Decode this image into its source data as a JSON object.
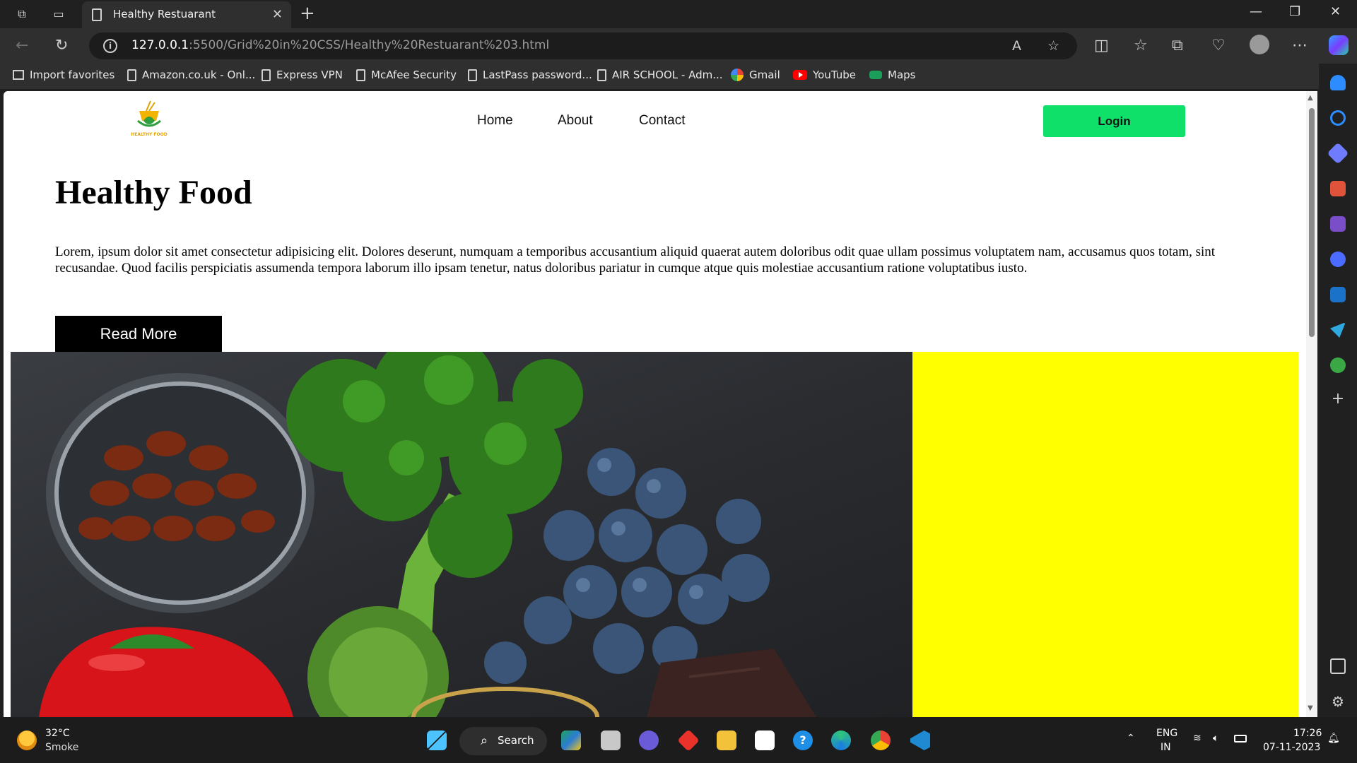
{
  "browser": {
    "tab_title": "Healthy Restuarant",
    "url_host": "127.0.0.1",
    "url_path": ":5500/Grid%20in%20CSS/Healthy%20Restuarant%203.html",
    "favorites": [
      {
        "label": "Import favorites",
        "icon": "import-icon"
      },
      {
        "label": "Amazon.co.uk - Onl...",
        "icon": "page-icon"
      },
      {
        "label": "Express VPN",
        "icon": "page-icon"
      },
      {
        "label": "McAfee Security",
        "icon": "page-icon"
      },
      {
        "label": "LastPass password...",
        "icon": "page-icon"
      },
      {
        "label": "AIR SCHOOL - Adm...",
        "icon": "page-icon"
      },
      {
        "label": "Gmail",
        "icon": "google-icon"
      },
      {
        "label": "YouTube",
        "icon": "youtube-icon"
      },
      {
        "label": "Maps",
        "icon": "maps-icon"
      }
    ]
  },
  "site": {
    "logo_text": "HEALTHY FOOD",
    "nav": [
      "Home",
      "About",
      "Contact"
    ],
    "login_label": "Login",
    "hero_title": "Healthy Food",
    "hero_text": "Lorem, ipsum dolor sit amet consectetur adipisicing elit. Dolores deserunt, numquam a temporibus accusantium aliquid quaerat autem doloribus odit quae ullam possimus voluptatem nam, accusamus quos totam, sint recusandae. Quod facilis perspiciatis assumenda tempora laborum illo ipsam tenetur, natus doloribus pariatur in cumque atque quis molestiae accusantium ratione voluptatibus iusto.",
    "read_more_label": "Read More",
    "panel_color": "#ffff00",
    "login_color": "#0ee06a"
  },
  "taskbar": {
    "weather_temp": "32°C",
    "weather_desc": "Smoke",
    "search_label": "Search",
    "lang_top": "ENG",
    "lang_bottom": "IN",
    "time": "17:26",
    "date": "07-11-2023"
  }
}
